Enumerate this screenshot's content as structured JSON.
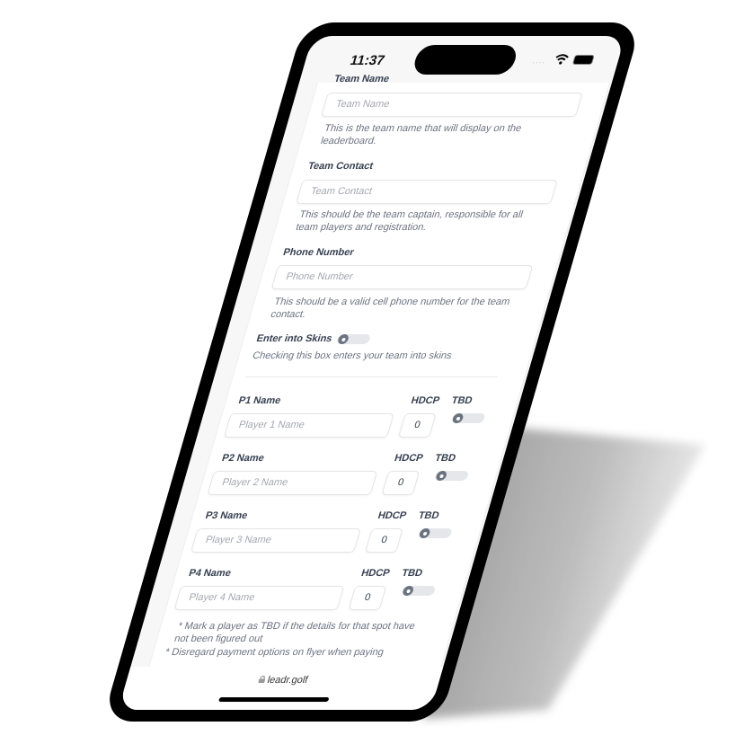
{
  "status_bar": {
    "time": "11:37",
    "signal_icon": "signal-dots-icon",
    "wifi_icon": "wifi-icon",
    "battery_icon": "battery-icon"
  },
  "form": {
    "team_name": {
      "label": "Team Name",
      "placeholder": "Team Name",
      "value": "",
      "help": [
        "This is the team name that will display on the",
        "leaderboard."
      ]
    },
    "team_contact": {
      "label": "Team Contact",
      "placeholder": "Team Contact",
      "value": "",
      "help": [
        "This should be the team captain, responsible for all",
        "team players and registration."
      ]
    },
    "phone_number": {
      "label": "Phone Number",
      "placeholder": "Phone Number",
      "value": "",
      "help": [
        "This should be a valid cell phone number for the team",
        "contact."
      ]
    },
    "skins": {
      "label": "Enter into Skins",
      "checked": false,
      "help": "Checking this box enters your team into skins"
    },
    "players": [
      {
        "label": "P1 Name",
        "placeholder": "Player 1 Name",
        "hdcp_label": "HDCP",
        "hdcp": "0",
        "tbd_label": "TBD",
        "tbd": false
      },
      {
        "label": "P2 Name",
        "placeholder": "Player 2 Name",
        "hdcp_label": "HDCP",
        "hdcp": "0",
        "tbd_label": "TBD",
        "tbd": false
      },
      {
        "label": "P3 Name",
        "placeholder": "Player 3 Name",
        "hdcp_label": "HDCP",
        "hdcp": "0",
        "tbd_label": "TBD",
        "tbd": false
      },
      {
        "label": "P4 Name",
        "placeholder": "Player 4 Name",
        "hdcp_label": "HDCP",
        "hdcp": "0",
        "tbd_label": "TBD",
        "tbd": false
      }
    ],
    "footnotes": [
      "* Mark a player as TBD if the details for that spot have",
      "not been figured out",
      "* Disregard payment options on flyer when paying"
    ]
  },
  "browser": {
    "url": "leadr.golf",
    "lock_icon": "lock-icon"
  }
}
